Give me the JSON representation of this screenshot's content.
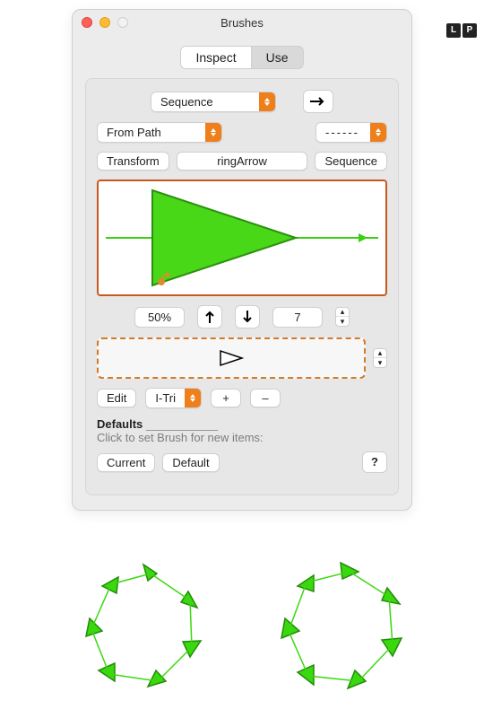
{
  "title": "Brushes",
  "badges": [
    "L",
    "P"
  ],
  "tabs": {
    "inspect": "Inspect",
    "use": "Use",
    "active": "use"
  },
  "mode_drop": "Sequence",
  "from_drop": "From Path",
  "dash_drop": "------",
  "buttons": {
    "transform": "Transform",
    "ring": "ringArrow",
    "sequence": "Sequence"
  },
  "percent": "50%",
  "count": "7",
  "edit": "Edit",
  "shape_drop": "I-Tri",
  "plus": "+",
  "minus": "–",
  "defaults_title": "Defaults",
  "defaults_hint": "Click to set Brush for new items:",
  "current": "Current",
  "default": "Default",
  "q": "?"
}
